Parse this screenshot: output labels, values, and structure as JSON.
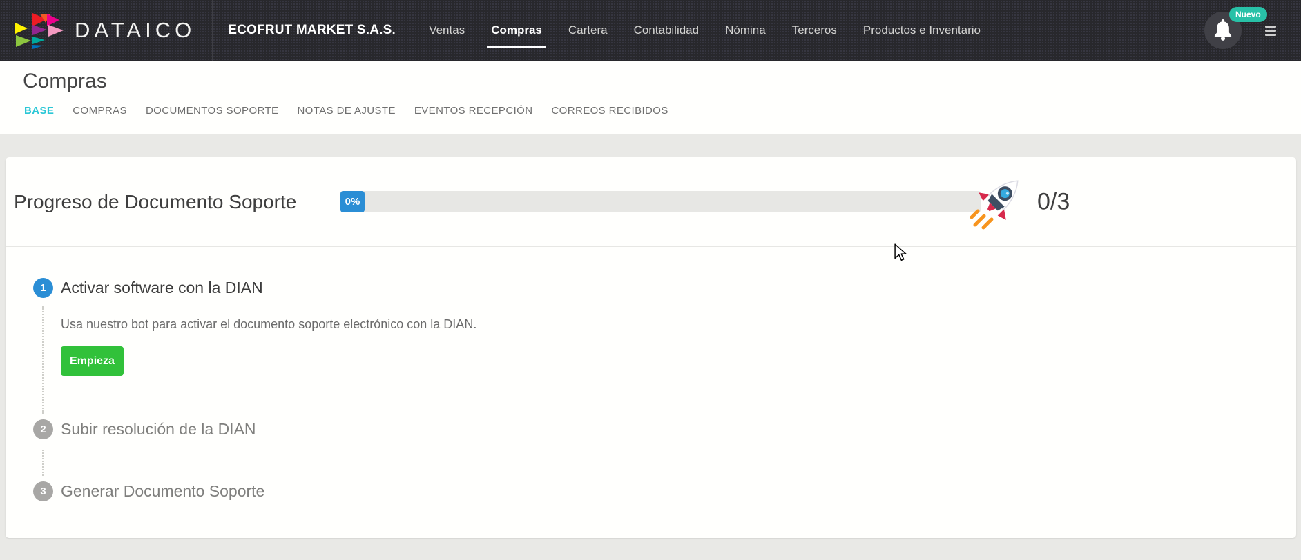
{
  "navbar": {
    "brand": "DATAICO",
    "company": "ECOFRUT MARKET S.A.S.",
    "items": [
      {
        "label": "Ventas",
        "active": false
      },
      {
        "label": "Compras",
        "active": true
      },
      {
        "label": "Cartera",
        "active": false
      },
      {
        "label": "Contabilidad",
        "active": false
      },
      {
        "label": "Nómina",
        "active": false
      },
      {
        "label": "Terceros",
        "active": false
      },
      {
        "label": "Productos e Inventario",
        "active": false
      }
    ],
    "notifications": {
      "badge": "Nuevo"
    }
  },
  "page": {
    "title": "Compras",
    "tabs": [
      {
        "label": "BASE",
        "active": true
      },
      {
        "label": "COMPRAS",
        "active": false
      },
      {
        "label": "DOCUMENTOS SOPORTE",
        "active": false
      },
      {
        "label": "NOTAS DE AJUSTE",
        "active": false
      },
      {
        "label": "EVENTOS RECEPCIÓN",
        "active": false
      },
      {
        "label": "CORREOS RECIBIDOS",
        "active": false
      }
    ]
  },
  "progress": {
    "title": "Progreso de Documento Soporte",
    "percent": "0%",
    "completed": "0/3"
  },
  "steps": [
    {
      "number": "1",
      "title": "Activar software con la DIAN",
      "description": "Usa nuestro bot para activar el documento soporte electrónico con la DIAN.",
      "button": "Empieza",
      "state": "active"
    },
    {
      "number": "2",
      "title": "Subir resolución de la DIAN",
      "state": "pending"
    },
    {
      "number": "3",
      "title": "Generar Documento Soporte",
      "state": "pending"
    }
  ],
  "icons": {
    "logo": "dataico-triangle-logo",
    "notification": "bell-icon",
    "menu": "hamburger-menu-icon",
    "progress": "rocket-icon",
    "pointer": "mouse-cursor-icon"
  },
  "colors": {
    "navbar_bg": "#28282c",
    "accent_blue": "#2b8ed5",
    "accent_green": "#31c13a",
    "accent_teal_tab": "#2cc7d6",
    "badge_teal": "#28c1a7",
    "pending_gray": "#a8a7a5",
    "progress_track": "#e7e7e4"
  }
}
